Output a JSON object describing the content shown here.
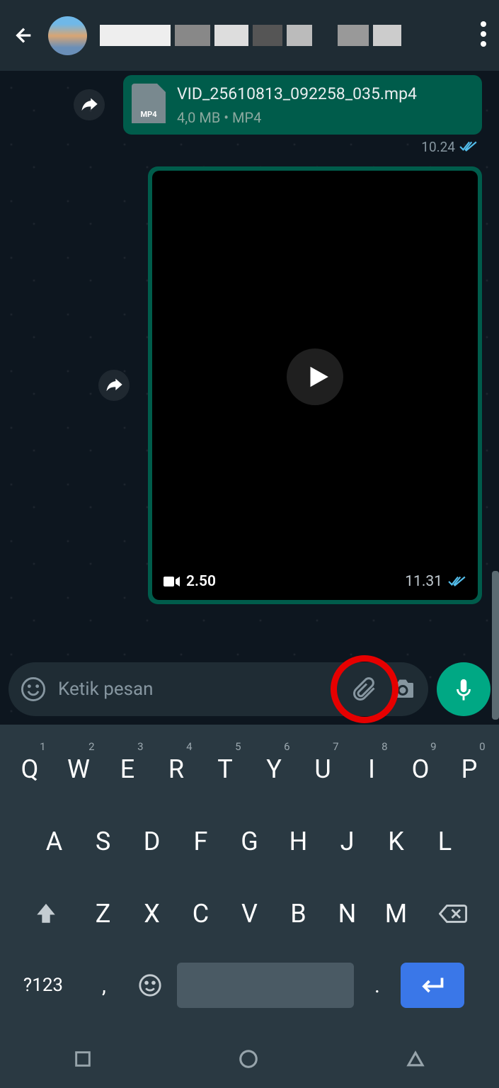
{
  "file_message": {
    "icon_label": "MP4",
    "filename": "VID_25610813_092258_035.mp4",
    "size": "4,0 MB",
    "type": "MP4",
    "time": "10.24"
  },
  "video_message": {
    "duration": "2.50",
    "time": "11.31"
  },
  "input": {
    "placeholder": "Ketik pesan"
  },
  "keyboard": {
    "row1": [
      {
        "k": "Q",
        "n": "1"
      },
      {
        "k": "W",
        "n": "2"
      },
      {
        "k": "E",
        "n": "3"
      },
      {
        "k": "R",
        "n": "4"
      },
      {
        "k": "T",
        "n": "5"
      },
      {
        "k": "Y",
        "n": "6"
      },
      {
        "k": "U",
        "n": "7"
      },
      {
        "k": "I",
        "n": "8"
      },
      {
        "k": "O",
        "n": "9"
      },
      {
        "k": "P",
        "n": "0"
      }
    ],
    "row2": [
      "A",
      "S",
      "D",
      "F",
      "G",
      "H",
      "J",
      "K",
      "L"
    ],
    "row3": [
      "Z",
      "X",
      "C",
      "V",
      "B",
      "N",
      "M"
    ],
    "sym": "?123",
    "comma": ",",
    "dot": "."
  }
}
